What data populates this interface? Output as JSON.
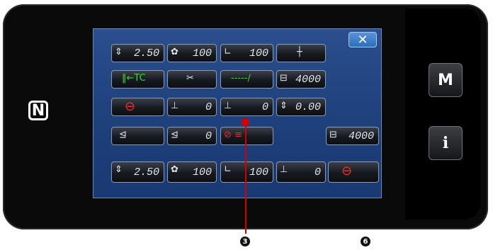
{
  "panel": {
    "close_label": "✕",
    "m_label": "M",
    "info_label": "i",
    "nfc_label": "N"
  },
  "buttons": [
    {
      "id": "r1c1",
      "icon": "⇕",
      "value": "2.50"
    },
    {
      "id": "r1c2",
      "icon": "✿",
      "value": "100"
    },
    {
      "id": "r1c3",
      "icon": "∟",
      "value": "100"
    },
    {
      "id": "r1c4",
      "icon": "┼",
      "value": ""
    },
    {
      "id": "r2c1",
      "icon": "‖←TC",
      "value": ""
    },
    {
      "id": "r2c2",
      "icon": "✂",
      "value": ""
    },
    {
      "id": "r2c3",
      "icon": "-----∕",
      "value": ""
    },
    {
      "id": "r2c4",
      "icon": "⊟",
      "value": "4000"
    },
    {
      "id": "r3c1",
      "icon": "⊖",
      "value": ""
    },
    {
      "id": "r3c2",
      "icon": "⊥",
      "value": "0"
    },
    {
      "id": "r3c3",
      "icon": "⊥",
      "value": "0"
    },
    {
      "id": "r3c4",
      "icon": "⇕",
      "value": "0.00"
    },
    {
      "id": "r4c1",
      "icon": "⊴",
      "value": ""
    },
    {
      "id": "r4c2",
      "icon": "⊴",
      "value": "0"
    },
    {
      "id": "r4c3",
      "icon": "⊘ ≡",
      "value": ""
    },
    {
      "id": "r4c5",
      "icon": "⊟",
      "value": "4000"
    },
    {
      "id": "r5c1",
      "icon": "⇕",
      "value": "2.50"
    },
    {
      "id": "r5c2",
      "icon": "✿",
      "value": "100"
    },
    {
      "id": "r5c3",
      "icon": "∟",
      "value": "100"
    },
    {
      "id": "r5c4",
      "icon": "⊥",
      "value": "0"
    },
    {
      "id": "r5c5",
      "icon": "⊖",
      "value": ""
    }
  ],
  "markers": {
    "callout_3": "3",
    "callout_6": "6"
  }
}
